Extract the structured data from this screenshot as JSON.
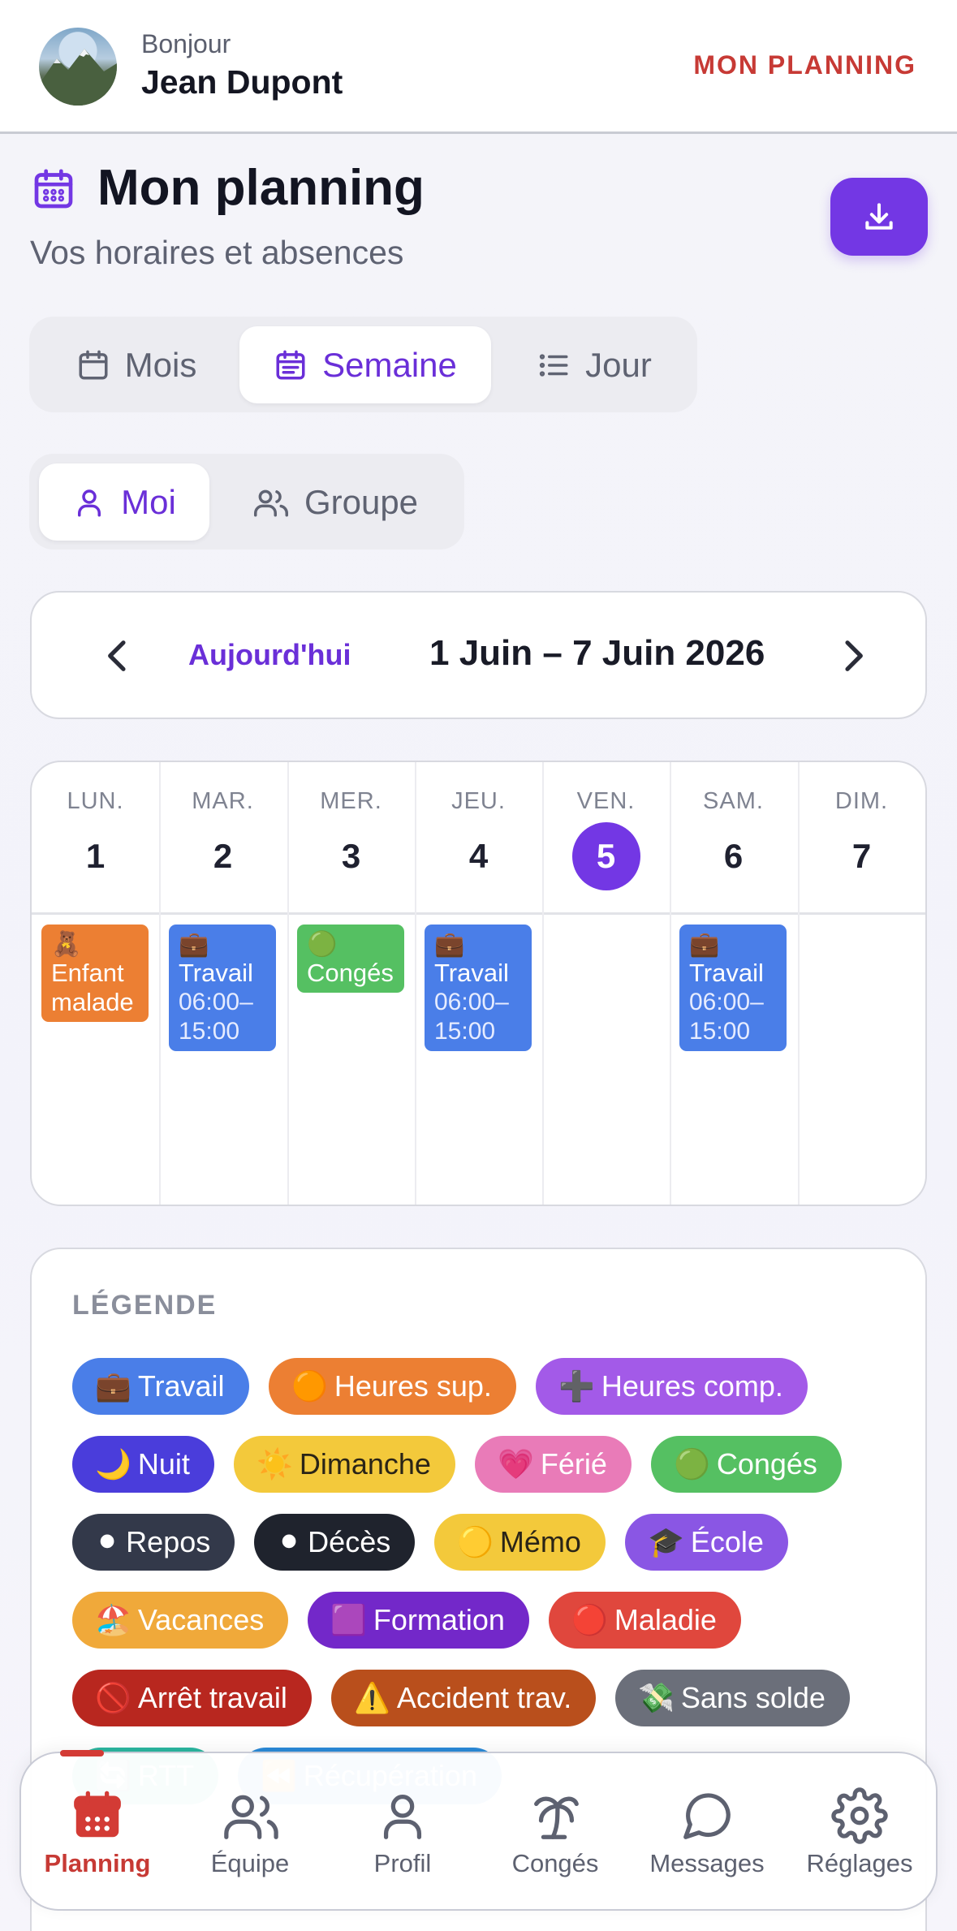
{
  "header": {
    "greeting": "Bonjour",
    "user_name": "Jean Dupont",
    "link": "MON PLANNING"
  },
  "page": {
    "title": "Mon planning",
    "subtitle": "Vos horaires et absences"
  },
  "view_tabs": [
    {
      "label": "Mois",
      "icon": "calendar-icon",
      "active": false
    },
    {
      "label": "Semaine",
      "icon": "calendar-week-icon",
      "active": true
    },
    {
      "label": "Jour",
      "icon": "list-icon",
      "active": false
    }
  ],
  "scope_tabs": [
    {
      "label": "Moi",
      "icon": "user-icon",
      "active": true
    },
    {
      "label": "Groupe",
      "icon": "users-icon",
      "active": false
    }
  ],
  "navigator": {
    "today_label": "Aujourd'hui",
    "range": "1 Juin – 7 Juin 2026"
  },
  "week": {
    "days": [
      {
        "name": "LUN.",
        "num": "1",
        "today": false
      },
      {
        "name": "MAR.",
        "num": "2",
        "today": false
      },
      {
        "name": "MER.",
        "num": "3",
        "today": false
      },
      {
        "name": "JEU.",
        "num": "4",
        "today": false
      },
      {
        "name": "VEN.",
        "num": "5",
        "today": true
      },
      {
        "name": "SAM.",
        "num": "6",
        "today": false
      },
      {
        "name": "DIM.",
        "num": "7",
        "today": false
      }
    ],
    "events": [
      {
        "day": 0,
        "emoji": "🧸",
        "line1": "Enfant",
        "line2": "malade",
        "time1": "",
        "time2": "",
        "color": "#ec7f33"
      },
      {
        "day": 1,
        "emoji": "💼",
        "line1": "Travail",
        "line2": "",
        "time1": "06:00–",
        "time2": "15:00",
        "color": "#4a7ee8"
      },
      {
        "day": 2,
        "emoji": "🟢",
        "line1": "Congés",
        "line2": "",
        "time1": "",
        "time2": "",
        "color": "#55c062"
      },
      {
        "day": 3,
        "emoji": "💼",
        "line1": "Travail",
        "line2": "",
        "time1": "06:00–",
        "time2": "15:00",
        "color": "#4a7ee8"
      },
      {
        "day": 5,
        "emoji": "💼",
        "line1": "Travail",
        "line2": "",
        "time1": "06:00–",
        "time2": "15:00",
        "color": "#4a7ee8"
      }
    ]
  },
  "legend": {
    "title": "LÉGENDE",
    "items": [
      {
        "emoji": "💼",
        "label": "Travail",
        "bg": "#4a7ee8",
        "fg": "#ffffff"
      },
      {
        "emoji": "🟠",
        "label": "Heures sup.",
        "bg": "#ec7f33",
        "fg": "#ffffff"
      },
      {
        "emoji": "➕",
        "label": "Heures comp.",
        "bg": "#a35ae8",
        "fg": "#ffffff"
      },
      {
        "emoji": "🌙",
        "label": "Nuit",
        "bg": "#4a3ddb",
        "fg": "#ffffff"
      },
      {
        "emoji": "☀️",
        "label": "Dimanche",
        "bg": "#f3c93b",
        "fg": "#2a2417"
      },
      {
        "emoji": "💗",
        "label": "Férié",
        "bg": "#e97bb8",
        "fg": "#ffffff"
      },
      {
        "emoji": "🟢",
        "label": "Congés",
        "bg": "#55c062",
        "fg": "#ffffff"
      },
      {
        "emoji": "⚫",
        "label": "Repos",
        "bg": "#33394a",
        "fg": "#ffffff"
      },
      {
        "emoji": "⚫",
        "label": "Décès",
        "bg": "#1f232d",
        "fg": "#ffffff"
      },
      {
        "emoji": "🟡",
        "label": "Mémo",
        "bg": "#f3c93b",
        "fg": "#2a2417"
      },
      {
        "emoji": "🎓",
        "label": "École",
        "bg": "#8a56e4",
        "fg": "#ffffff"
      },
      {
        "emoji": "🏖️",
        "label": "Vacances",
        "bg": "#f0a93a",
        "fg": "#ffffff"
      },
      {
        "emoji": "🟪",
        "label": "Formation",
        "bg": "#7328c9",
        "fg": "#ffffff"
      },
      {
        "emoji": "🔴",
        "label": "Maladie",
        "bg": "#e0473d",
        "fg": "#ffffff"
      },
      {
        "emoji": "🚫",
        "label": "Arrêt travail",
        "bg": "#b8271f",
        "fg": "#ffffff"
      },
      {
        "emoji": "⚠️",
        "label": "Accident trav.",
        "bg": "#b94f1c",
        "fg": "#ffffff"
      },
      {
        "emoji": "💸",
        "label": "Sans solde",
        "bg": "#6b6f7a",
        "fg": "#ffffff"
      },
      {
        "emoji": "🔄",
        "label": "RTT",
        "bg": "#2bb6a0",
        "fg": "#ffffff"
      },
      {
        "emoji": "⏪",
        "label": "Récupération",
        "bg": "#2b8ad8",
        "fg": "#ffffff"
      }
    ]
  },
  "tabbar": [
    {
      "label": "Planning",
      "icon": "calendar-icon",
      "active": true
    },
    {
      "label": "Équipe",
      "icon": "users-icon",
      "active": false
    },
    {
      "label": "Profil",
      "icon": "user-icon",
      "active": false
    },
    {
      "label": "Congés",
      "icon": "palm-tree-icon",
      "active": false
    },
    {
      "label": "Messages",
      "icon": "message-icon",
      "active": false
    },
    {
      "label": "Réglages",
      "icon": "gear-icon",
      "active": false
    }
  ]
}
